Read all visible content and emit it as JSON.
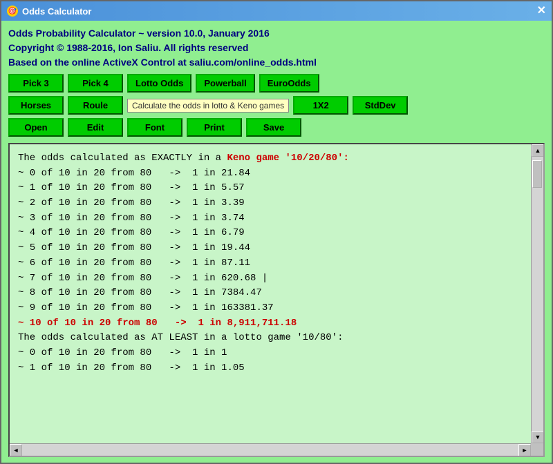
{
  "window": {
    "title": "Odds Calculator",
    "icon_symbol": "🎯",
    "close_button": "✕"
  },
  "header": {
    "line1": "Odds Probability Calculator ~ version 10.0, January 2016",
    "line2": "Copyright © 1988-2016, Ion Saliu. All rights reserved",
    "line3": "Based on the online ActiveX Control at saliu.com/online_odds.html"
  },
  "toolbar_row1": {
    "btn1": "Pick 3",
    "btn2": "Pick 4",
    "btn3": "Lotto Odds",
    "btn4": "Powerball",
    "btn5": "EuroOdds"
  },
  "toolbar_row2": {
    "btn1": "Horses",
    "btn2": "Roule",
    "tooltip": "Calculate the odds in lotto & Keno games",
    "btn3": "1X2",
    "btn4": "StdDev"
  },
  "toolbar_row3": {
    "btn1": "Open",
    "btn2": "Edit",
    "btn3": "Font",
    "btn4": "Print",
    "btn5": "Save"
  },
  "output": {
    "lines": [
      {
        "text": "",
        "style": "normal"
      },
      {
        "text": "The odds calculated as EXACTLY in a ",
        "style": "normal",
        "suffix": "Keno game '10/20/80':",
        "suffix_style": "red-bold"
      },
      {
        "text": "",
        "style": "normal"
      },
      {
        "text": "~ 0 of 10 in 20 from 80   ->  1 in 21.84",
        "style": "normal"
      },
      {
        "text": "~ 1 of 10 in 20 from 80   ->  1 in 5.57",
        "style": "normal"
      },
      {
        "text": "~ 2 of 10 in 20 from 80   ->  1 in 3.39",
        "style": "normal"
      },
      {
        "text": "~ 3 of 10 in 20 from 80   ->  1 in 3.74",
        "style": "normal"
      },
      {
        "text": "~ 4 of 10 in 20 from 80   ->  1 in 6.79",
        "style": "normal"
      },
      {
        "text": "~ 5 of 10 in 20 from 80   ->  1 in 19.44",
        "style": "normal"
      },
      {
        "text": "~ 6 of 10 in 20 from 80   ->  1 in 87.11",
        "style": "normal"
      },
      {
        "text": "~ 7 of 10 in 20 from 80   ->  1 in 620.68 |",
        "style": "normal"
      },
      {
        "text": "~ 8 of 10 in 20 from 80   ->  1 in 7384.47",
        "style": "normal"
      },
      {
        "text": "~ 9 of 10 in 20 from 80   ->  1 in 163381.37",
        "style": "normal"
      },
      {
        "text": "~ 10 of 10 in 20 from 80   ->  1 in 8,911,711.18",
        "style": "red-bold"
      },
      {
        "text": "",
        "style": "normal"
      },
      {
        "text": "The odds calculated as AT LEAST in a lotto game '10/80':",
        "style": "normal"
      },
      {
        "text": "",
        "style": "normal"
      },
      {
        "text": "~ 0 of 10 in 20 from 80   ->  1 in 1",
        "style": "normal"
      },
      {
        "text": "~ 1 of 10 in 20 from 80   ->  1 in 1.05",
        "style": "normal"
      }
    ]
  },
  "scrollbar": {
    "up_arrow": "▲",
    "down_arrow": "▼",
    "left_arrow": "◄",
    "right_arrow": "►"
  }
}
